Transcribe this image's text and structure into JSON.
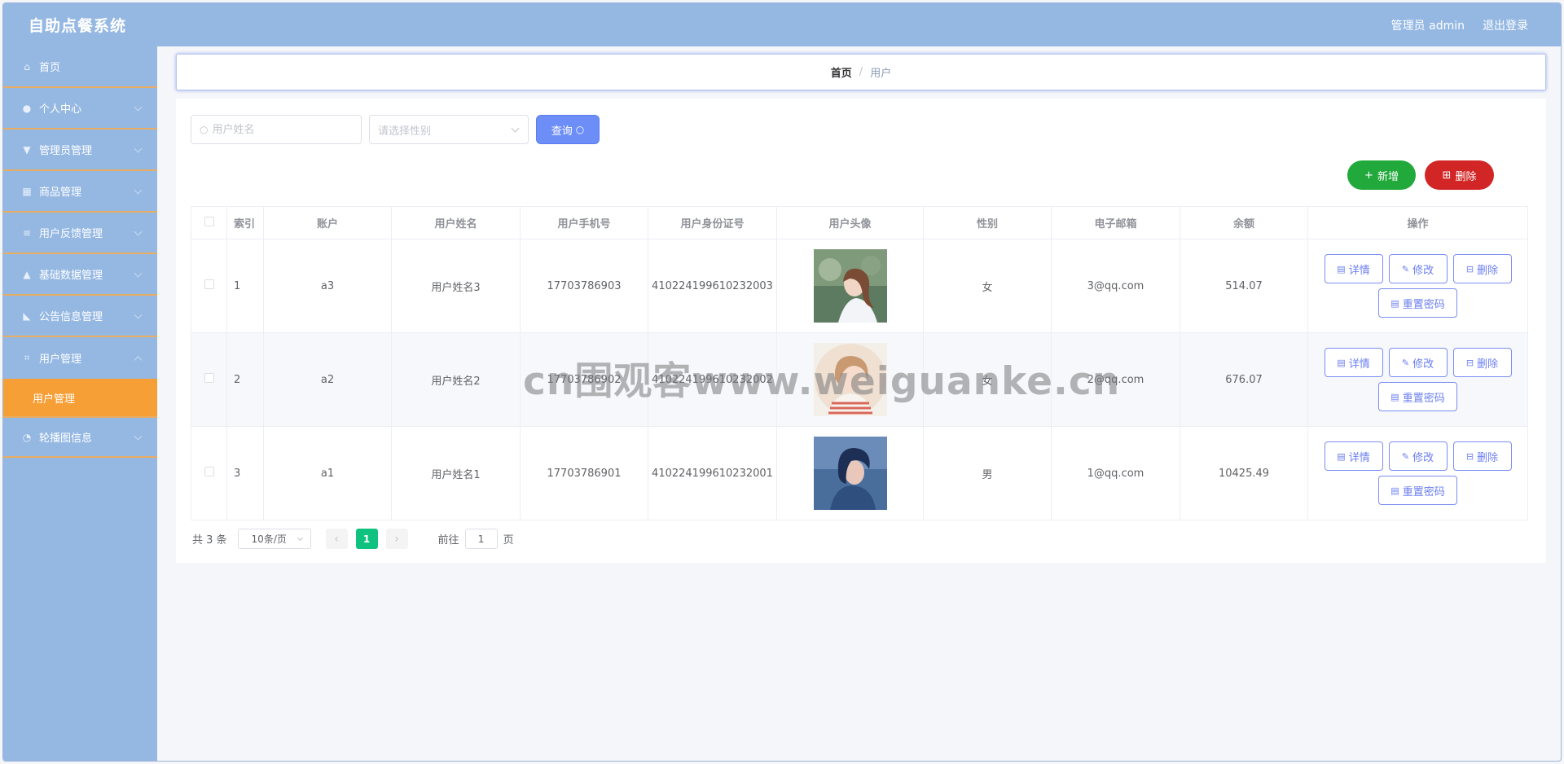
{
  "header": {
    "title": "自助点餐系统",
    "user_label": "管理员 admin",
    "logout_label": "退出登录"
  },
  "sidebar": {
    "items": [
      {
        "label": "首页",
        "icon": "home-icon"
      },
      {
        "label": "个人中心",
        "icon": "user-icon"
      },
      {
        "label": "管理员管理",
        "icon": "stamp-icon"
      },
      {
        "label": "商品管理",
        "icon": "grid-icon"
      },
      {
        "label": "用户反馈管理",
        "icon": "menu-icon"
      },
      {
        "label": "基础数据管理",
        "icon": "person-icon"
      },
      {
        "label": "公告信息管理",
        "icon": "thumb-icon"
      },
      {
        "label": "用户管理",
        "icon": "crop-icon"
      },
      {
        "label": "轮播图信息",
        "icon": "gauge-icon"
      }
    ],
    "active_sub": "用户管理"
  },
  "breadcrumb": {
    "home": "首页",
    "current": "用户"
  },
  "filters": {
    "name_placeholder": "用户姓名",
    "gender_placeholder": "请选择性别",
    "query_label": "查询"
  },
  "actions": {
    "add_label": "新增",
    "delete_label": "删除"
  },
  "table": {
    "headers": [
      "索引",
      "账户",
      "用户姓名",
      "用户手机号",
      "用户身份证号",
      "用户头像",
      "性别",
      "电子邮箱",
      "余额",
      "操作"
    ],
    "rows": [
      {
        "index": "1",
        "account": "a3",
        "name": "用户姓名3",
        "phone": "17703786903",
        "id_card": "410224199610232003",
        "gender": "女",
        "email": "3@qq.com",
        "balance": "514.07"
      },
      {
        "index": "2",
        "account": "a2",
        "name": "用户姓名2",
        "phone": "17703786902",
        "id_card": "410224199610232002",
        "gender": "女",
        "email": "2@qq.com",
        "balance": "676.07"
      },
      {
        "index": "3",
        "account": "a1",
        "name": "用户姓名1",
        "phone": "17703786901",
        "id_card": "410224199610232001",
        "gender": "男",
        "email": "1@qq.com",
        "balance": "10425.49"
      }
    ],
    "op_labels": {
      "detail": "详情",
      "edit": "修改",
      "delete": "删除",
      "reset": "重置密码"
    }
  },
  "pagination": {
    "total": "共 3 条",
    "page_size": "10条/页",
    "current_page": "1",
    "goto_prefix": "前往",
    "goto_value": "1",
    "goto_suffix": "页"
  },
  "watermark": "cn围观客www.weiguanke.cn",
  "colors": {
    "header_bg": "#95b8e3",
    "active_menu": "#f79f37",
    "primary": "#6e8ef7",
    "add_green": "#22a93b",
    "delete_red": "#d22525",
    "page_green": "#10c27f"
  }
}
